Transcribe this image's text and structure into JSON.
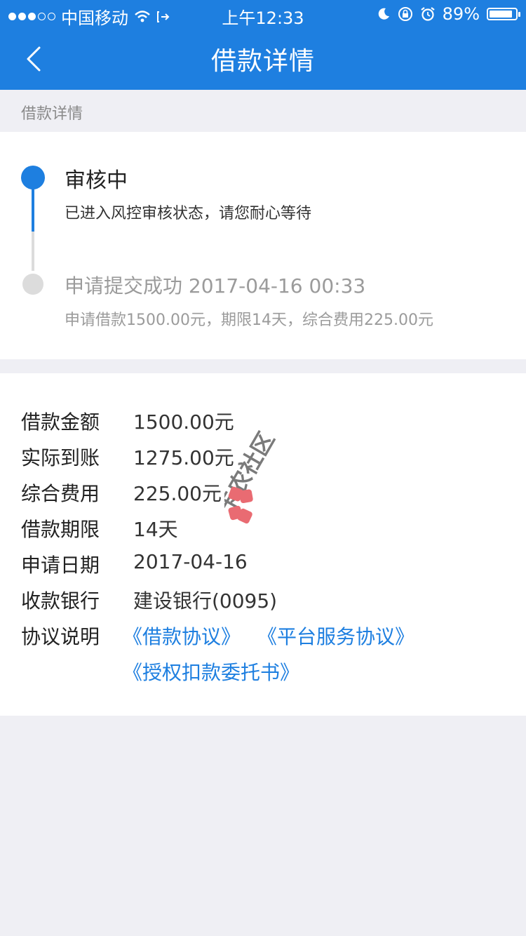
{
  "status_bar": {
    "carrier": "中国移动",
    "time": "上午12:33",
    "battery_percent": "89%",
    "battery_level": 0.89
  },
  "nav": {
    "title": "借款详情",
    "back_icon": "chevron-left-icon"
  },
  "section": {
    "header": "借款详情"
  },
  "timeline": {
    "current": {
      "title": "审核中",
      "desc": "已进入风控审核状态，请您耐心等待"
    },
    "submitted": {
      "title": "申请提交成功 2017-04-16 00:33",
      "desc": "申请借款1500.00元，期限14天，综合费用225.00元"
    }
  },
  "details": {
    "rows": [
      {
        "label": "借款金额",
        "value": "1500.00元"
      },
      {
        "label": "实际到账",
        "value": "1275.00元"
      },
      {
        "label": "综合费用",
        "value": "225.00元"
      },
      {
        "label": "借款期限",
        "value": "14天"
      },
      {
        "label": "申请日期",
        "value": "2017-04-16"
      },
      {
        "label": "收款银行",
        "value": "建设银行(0095)"
      }
    ],
    "agreements_label": "协议说明",
    "agreements": [
      "《借款协议》",
      "《平台服务协议》",
      "《授权扣款委托书》"
    ]
  },
  "watermark": {
    "text": "卡农社区"
  },
  "colors": {
    "accent": "#1e7fe0",
    "background": "#efeff4",
    "muted_text": "#9b9b9b"
  }
}
